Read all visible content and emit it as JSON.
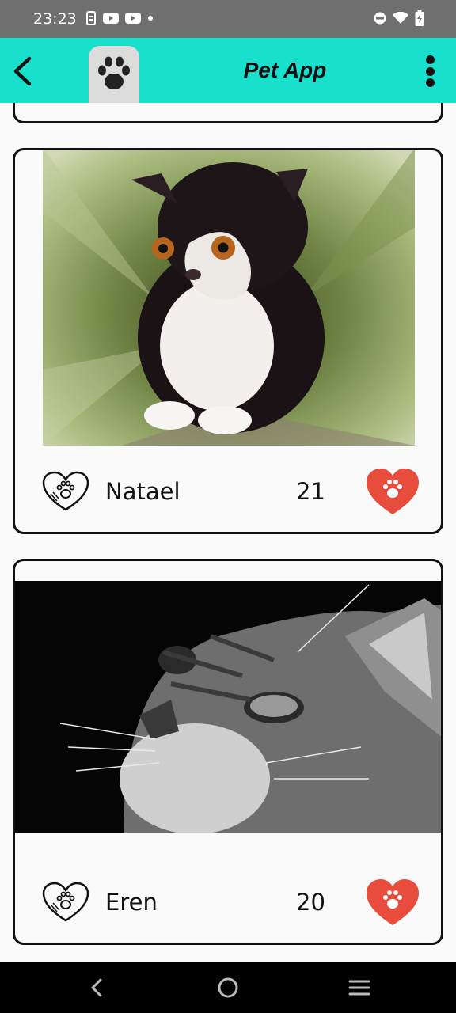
{
  "status_bar": {
    "time": "23:23",
    "left_icons": [
      "screenshot-icon",
      "youtube-icon",
      "youtube-icon",
      "dot-icon"
    ],
    "right_icons": [
      "do-not-disturb-icon",
      "wifi-icon",
      "battery-charging-icon"
    ]
  },
  "app_bar": {
    "title": "Pet App",
    "background": "#19e0cc",
    "logo_icon": "paw-icon",
    "back_icon": "chevron-left-icon",
    "menu_icon": "more-vertical-icon"
  },
  "pets": [
    {
      "name": "Natael",
      "count": "21",
      "photo": "black-and-white-persian-kitten",
      "outline_icon": "heart-paw-outline-icon",
      "like_icon": "heart-paw-filled-icon"
    },
    {
      "name": "Eren",
      "count": "20",
      "photo": "grayscale-tabby-cat-closeup",
      "outline_icon": "heart-paw-outline-icon",
      "like_icon": "heart-paw-filled-icon"
    }
  ],
  "colors": {
    "like": "#e84c3d",
    "card_border": "#111111"
  },
  "nav_bar": {
    "buttons": [
      "back-icon",
      "home-icon",
      "recents-icon"
    ]
  }
}
